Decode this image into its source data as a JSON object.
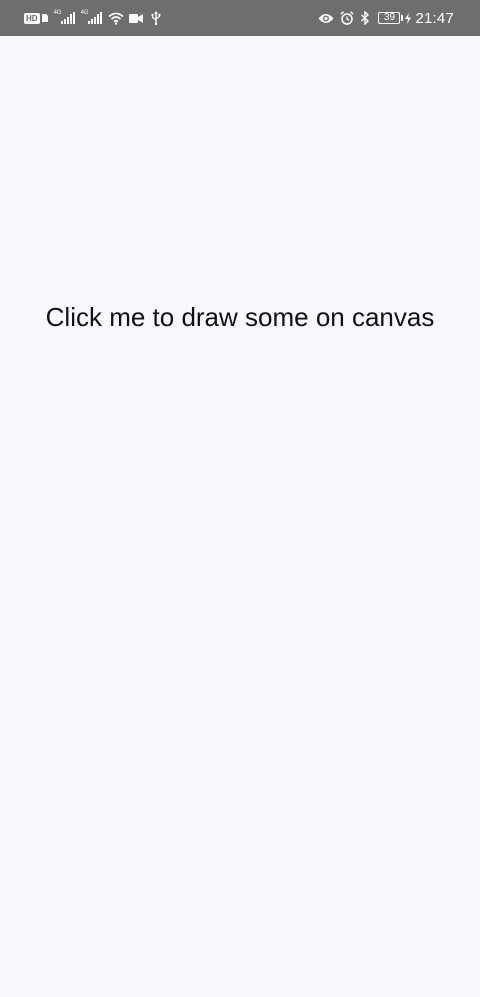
{
  "status_bar": {
    "left_icons": [
      "hd-icon",
      "signal-4g-icon",
      "signal-4g-icon",
      "wifi-icon",
      "video-camera-icon",
      "usb-icon"
    ],
    "hd_label": "HD",
    "network_label": "4G",
    "right_icons": [
      "eye-icon",
      "alarm-icon",
      "bluetooth-icon",
      "battery-icon",
      "charging-icon"
    ],
    "battery_level": "39",
    "time": "21:47",
    "background_color": "#6e6e6e"
  },
  "main": {
    "background_color": "#f7f9fd",
    "draw_button_label": "Click me to draw some on canvas"
  }
}
